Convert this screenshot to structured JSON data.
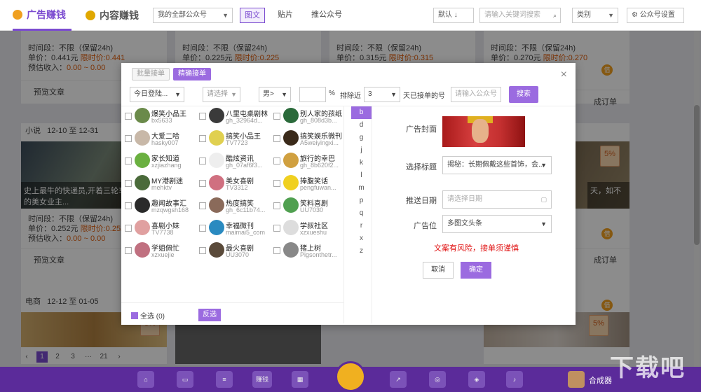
{
  "topbar": {
    "tab_ad": "广告赚钱",
    "tab_content": "内容赚钱",
    "account_select": "我的全部公众号",
    "btn_tuwen": "图文",
    "btn_tiepian": "贴片",
    "btn_tui": "推公众号",
    "sort_select": "默认 ↓",
    "keyword_placeholder": "请输入关键词搜索",
    "category_select": "类别",
    "settings_label": "公众号设置"
  },
  "cards_row1": [
    {
      "period": "时间段：不限（保留24h)",
      "price_label": "单价：0.441元",
      "price_limited": "限时价:0.441",
      "income": "预估收入：",
      "income_value": "0.00 ~ 0.00"
    },
    {
      "period": "时间段：不限（保留24h)",
      "price_label": "单价：0.225元",
      "price_limited": "限时价:0.225"
    },
    {
      "period": "时间段：不限（保留24h)",
      "price_label": "单价：0.315元",
      "price_limited": "限时价:0.315"
    },
    {
      "period": "时间段：不限（保留24h)",
      "price_label": "单价：0.270元",
      "price_limited": "限时价:0.270"
    }
  ],
  "card_actions": {
    "preview": "预览文章",
    "generate": "生成",
    "order": "成订单"
  },
  "section_xiaoshuo": {
    "category": "小说",
    "dates": "12-10 至 12-31",
    "caption": "史上最牛的快递员,开着三轮车个住别墅的美女业主...",
    "right_caption": "天，如不"
  },
  "cards_row2_left": {
    "period": "时间段：不限（保留24h)",
    "price_label": "单价：0.252元",
    "price_limited": "限时价:0.252",
    "income": "预估收入：",
    "income_value": "0.00 ~ 0.00"
  },
  "section_dianshang": {
    "category": "电商",
    "dates": "12-12 至 01-05"
  },
  "badge": "5%",
  "coin": "借",
  "pager": [
    "1",
    "2",
    "3",
    "···",
    "21"
  ],
  "dock": {
    "label": "合成器",
    "center": "赚钱"
  },
  "watermark": "下载吧",
  "modal": {
    "tab_batch": "批量接单",
    "tab_precise": "精确接单",
    "close": "×",
    "filter": {
      "login": "今日登陆...",
      "choose": "请选择",
      "gender": "男>",
      "percent_sign": "%",
      "exclude_label": "排除近",
      "exclude_days": "3",
      "exclude_suffix": "天已接单的号",
      "account_placeholder": "请输入公众号",
      "search": "搜索"
    },
    "accounts": [
      {
        "name": "爆笑小品王",
        "id": "bx5633"
      },
      {
        "name": "八里屯桌剧林",
        "id": "gh_32964d..."
      },
      {
        "name": "别人家的孩纸",
        "id": "gh_808d3b..."
      },
      {
        "name": "大爱二哈",
        "id": "hasky007"
      },
      {
        "name": "搞笑小品王",
        "id": "TV7723"
      },
      {
        "name": "搞笑娱乐微刊",
        "id": "A5weiyingxi..."
      },
      {
        "name": "家长知道",
        "id": "xzjiazhang"
      },
      {
        "name": "酷炫资讯",
        "id": "gh_07af6f3..."
      },
      {
        "name": "旅行的幸巴",
        "id": "gh_8b620f2..."
      },
      {
        "name": "MY港剧迷",
        "id": "mehktv"
      },
      {
        "name": "美女喜剧",
        "id": "TV3312"
      },
      {
        "name": "捧腹笑话",
        "id": "pengfuwan..."
      },
      {
        "name": "趣闻故事汇",
        "id": "mzqwgsh168"
      },
      {
        "name": "热度搞笑",
        "id": "gh_6c11b74..."
      },
      {
        "name": "笑料喜剧",
        "id": "UU7030"
      },
      {
        "name": "喜剧小妹",
        "id": "TV7738"
      },
      {
        "name": "幸福微刊",
        "id": "maimai5_com"
      },
      {
        "name": "学叔社区",
        "id": "xzxueshu"
      },
      {
        "name": "学姐佩忙",
        "id": "xzxuejie"
      },
      {
        "name": "最火喜剧",
        "id": "UU3070"
      },
      {
        "name": "猪上树",
        "id": "Pigsonthetr..."
      }
    ],
    "select_all": "全选 (0)",
    "invert": "反选",
    "letters": [
      "b",
      "d",
      "g",
      "j",
      "k",
      "l",
      "m",
      "p",
      "q",
      "r",
      "x",
      "z"
    ],
    "form": {
      "cover_label": "广告封面",
      "title_label": "选择标题",
      "title_value": "揭秘：长期佩戴这些首饰，会...",
      "date_label": "推送日期",
      "date_placeholder": "请选择日期",
      "position_label": "广告位",
      "position_value": "多图文头条",
      "risk": "文案有风险，接单须谨慎",
      "cancel": "取消",
      "ok": "确定"
    }
  },
  "colors": {
    "accent": "#9b6be0",
    "dock": "#5b2b9a",
    "orange": "#e06010"
  }
}
